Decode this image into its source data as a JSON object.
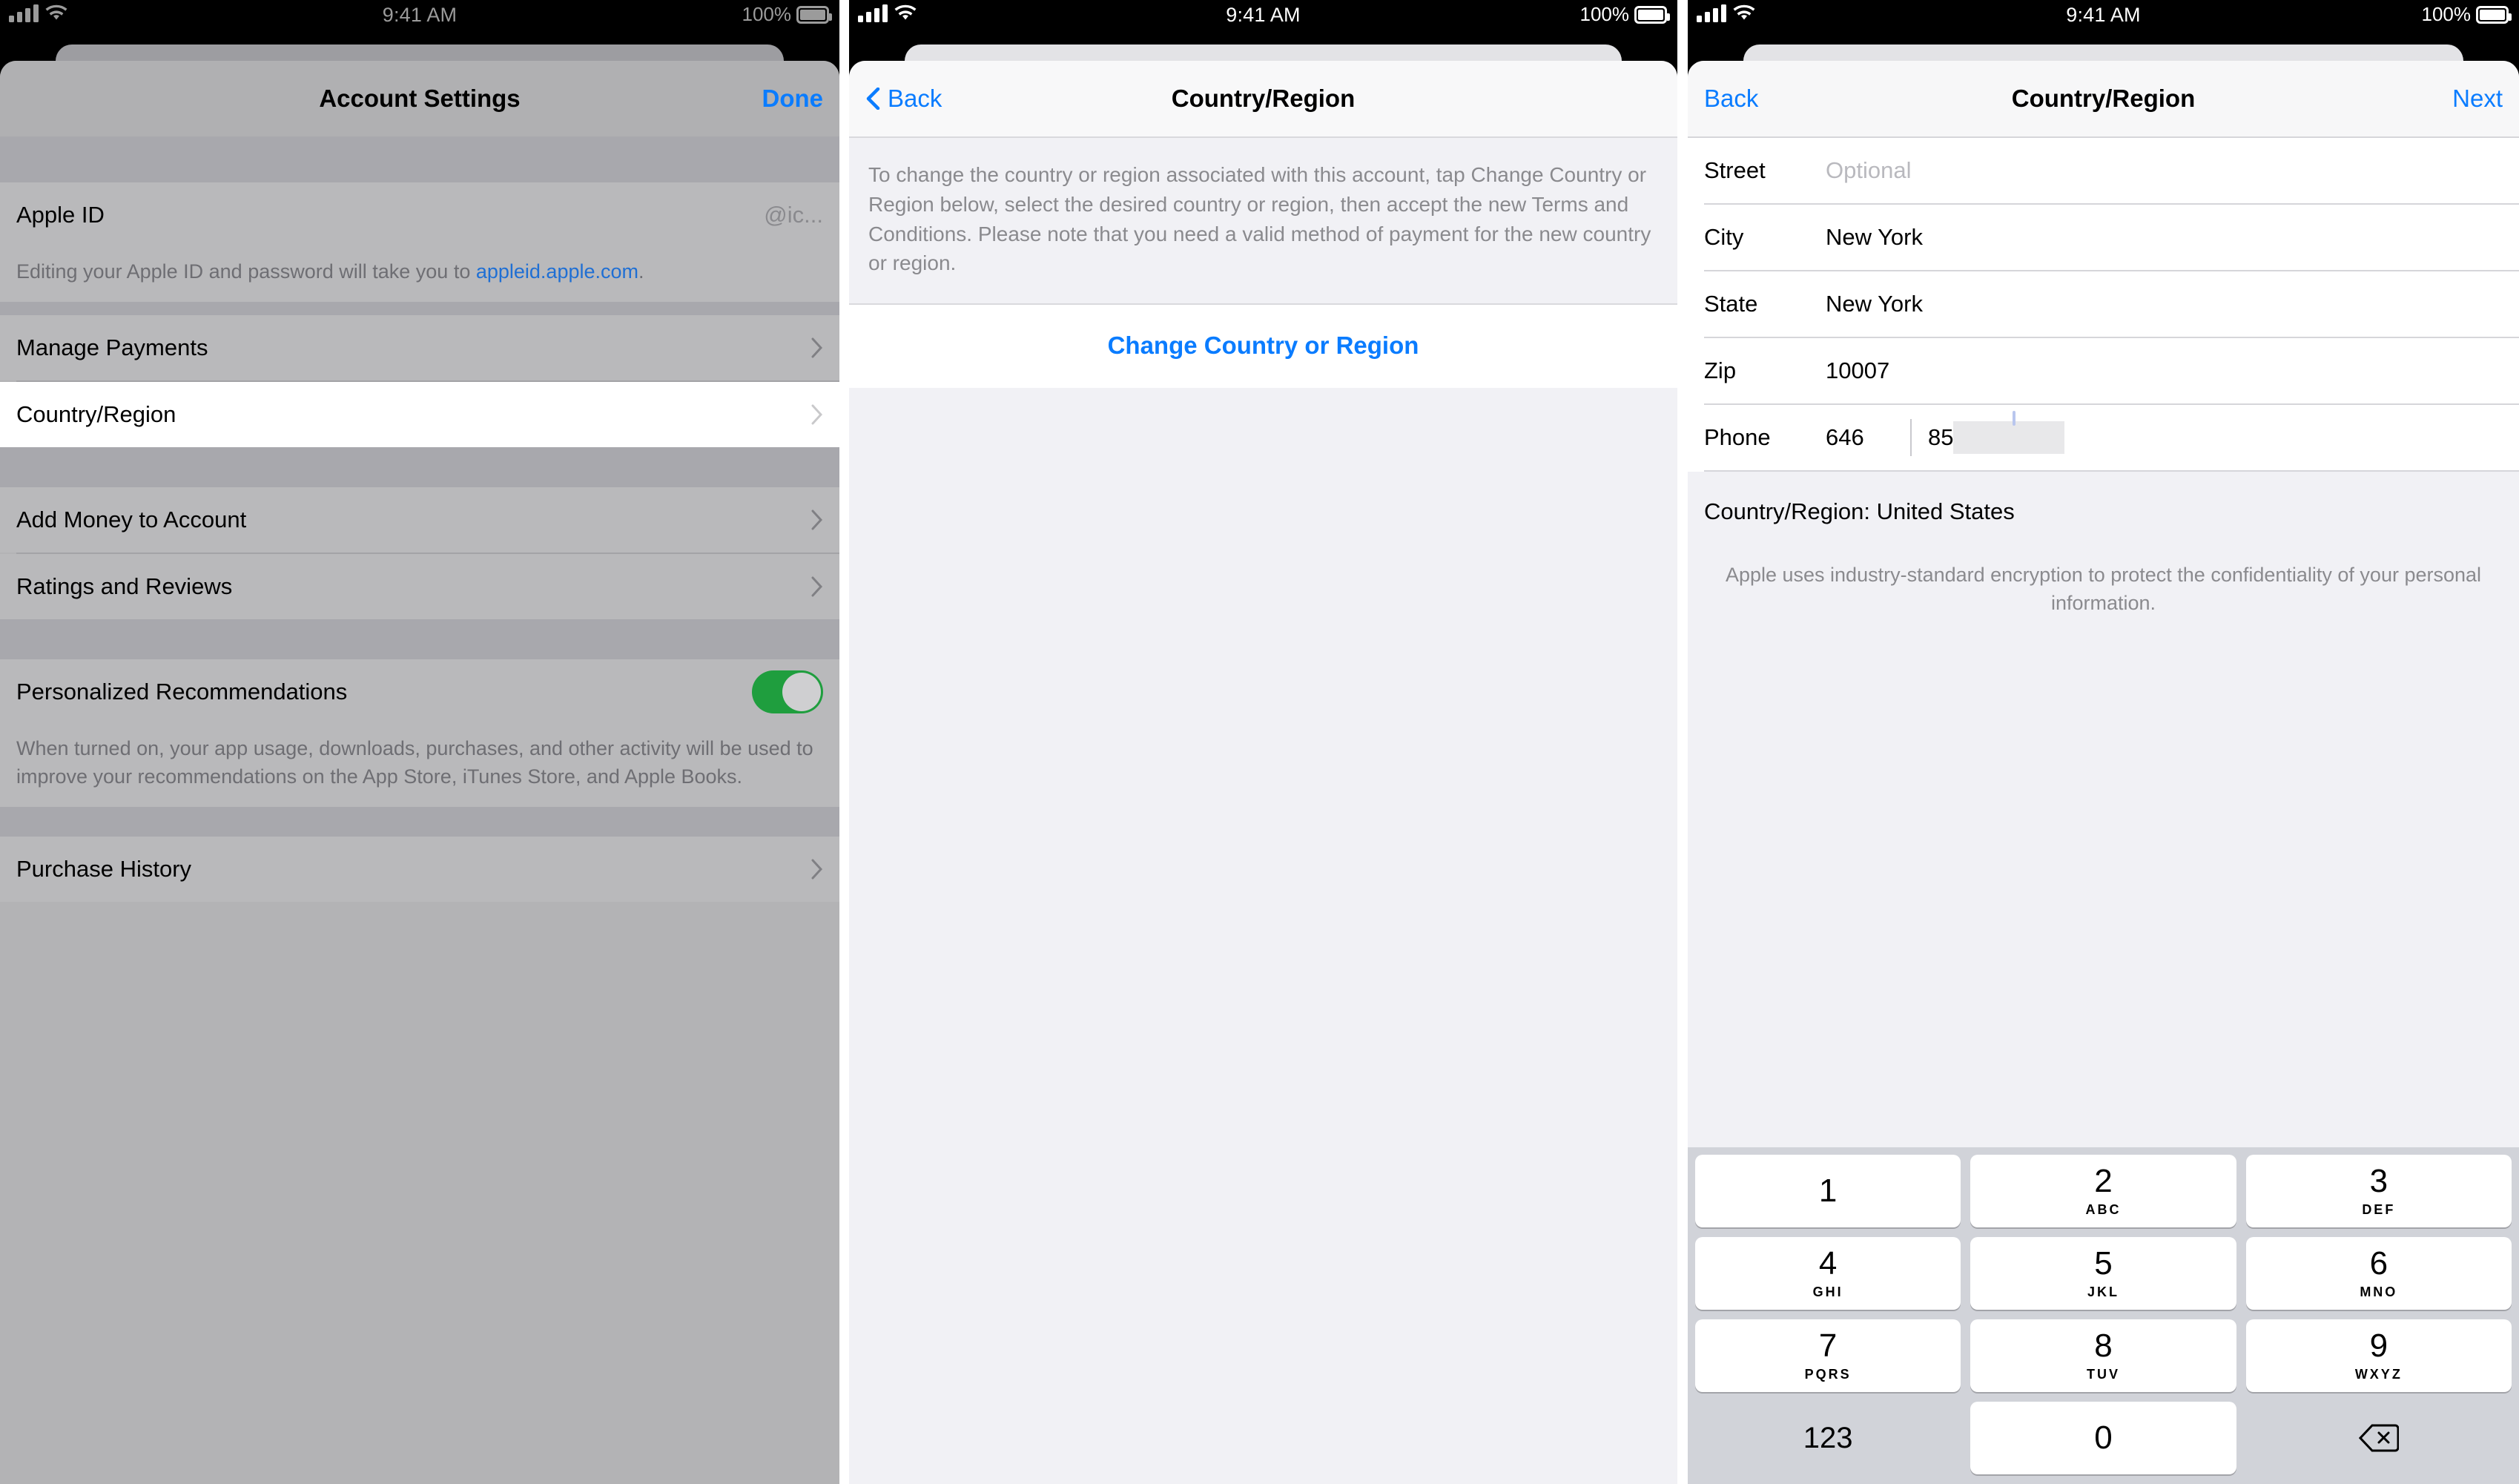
{
  "status_bar": {
    "time": "9:41 AM",
    "battery_percent": "100%",
    "signal_icon": "cellular-signal-icon",
    "wifi_icon": "wifi-icon",
    "battery_icon": "battery-full-icon"
  },
  "panel1": {
    "nav": {
      "title": "Account Settings",
      "right_button": "Done"
    },
    "rows": [
      {
        "label": "Apple ID",
        "value": "@ic..."
      },
      {
        "label": "Manage Payments",
        "accessory": "chevron-right-icon"
      },
      {
        "label": "Country/Region",
        "accessory": "chevron-right-icon",
        "highlighted": true
      },
      {
        "label": "Add Money to Account",
        "accessory": "chevron-right-icon"
      },
      {
        "label": "Ratings and Reviews",
        "accessory": "chevron-right-icon"
      },
      {
        "label": "Personalized Recommendations",
        "accessory": "toggle-on"
      },
      {
        "label": "Purchase History",
        "accessory": "chevron-right-icon"
      }
    ],
    "appleid_footnote_pre": "Editing your Apple ID and password will take you to ",
    "appleid_footnote_link": "appleid.apple.com",
    "appleid_footnote_post": ".",
    "recommendations_footnote": "When turned on, your app usage, downloads, purchases, and other activity will be used to improve your recommendations on the App Store, iTunes Store, and Apple Books.",
    "toggle_state": "on",
    "toggle_color": "#1f9e3e"
  },
  "panel2": {
    "nav": {
      "back_button": "Back",
      "title": "Country/Region",
      "back_icon": "chevron-left-icon"
    },
    "note": "To change the country or region associated with this account, tap Change Country or Region below, select the desired country or region, then accept the new Terms and Conditions. Please note that you need a valid method of payment for the new country or region.",
    "action_button": "Change Country or Region",
    "action_color": "#0a7cff"
  },
  "panel3": {
    "nav": {
      "back_button": "Back",
      "title": "Country/Region",
      "next_button": "Next"
    },
    "fields": [
      {
        "label": "Street",
        "value": "",
        "placeholder": "Optional"
      },
      {
        "label": "City",
        "value": "New York",
        "placeholder": ""
      },
      {
        "label": "State",
        "value": "New York",
        "placeholder": ""
      },
      {
        "label": "Zip",
        "value": "10007",
        "placeholder": ""
      }
    ],
    "phone": {
      "label": "Phone",
      "area_code": "646",
      "number_visible": "85",
      "redacted": true
    },
    "region_line": "Country/Region: United States",
    "disclaimer": "Apple uses industry-standard encryption to protect the confidentiality of your personal information.",
    "keypad": {
      "keys": [
        {
          "digit": "1",
          "letters": ""
        },
        {
          "digit": "2",
          "letters": "ABC"
        },
        {
          "digit": "3",
          "letters": "DEF"
        },
        {
          "digit": "4",
          "letters": "GHI"
        },
        {
          "digit": "5",
          "letters": "JKL"
        },
        {
          "digit": "6",
          "letters": "MNO"
        },
        {
          "digit": "7",
          "letters": "PQRS"
        },
        {
          "digit": "8",
          "letters": "TUV"
        },
        {
          "digit": "9",
          "letters": "WXYZ"
        }
      ],
      "switch_label": "123",
      "zero": "0",
      "delete_icon": "backspace-delete-icon",
      "background_color": "#d1d3d9"
    }
  }
}
